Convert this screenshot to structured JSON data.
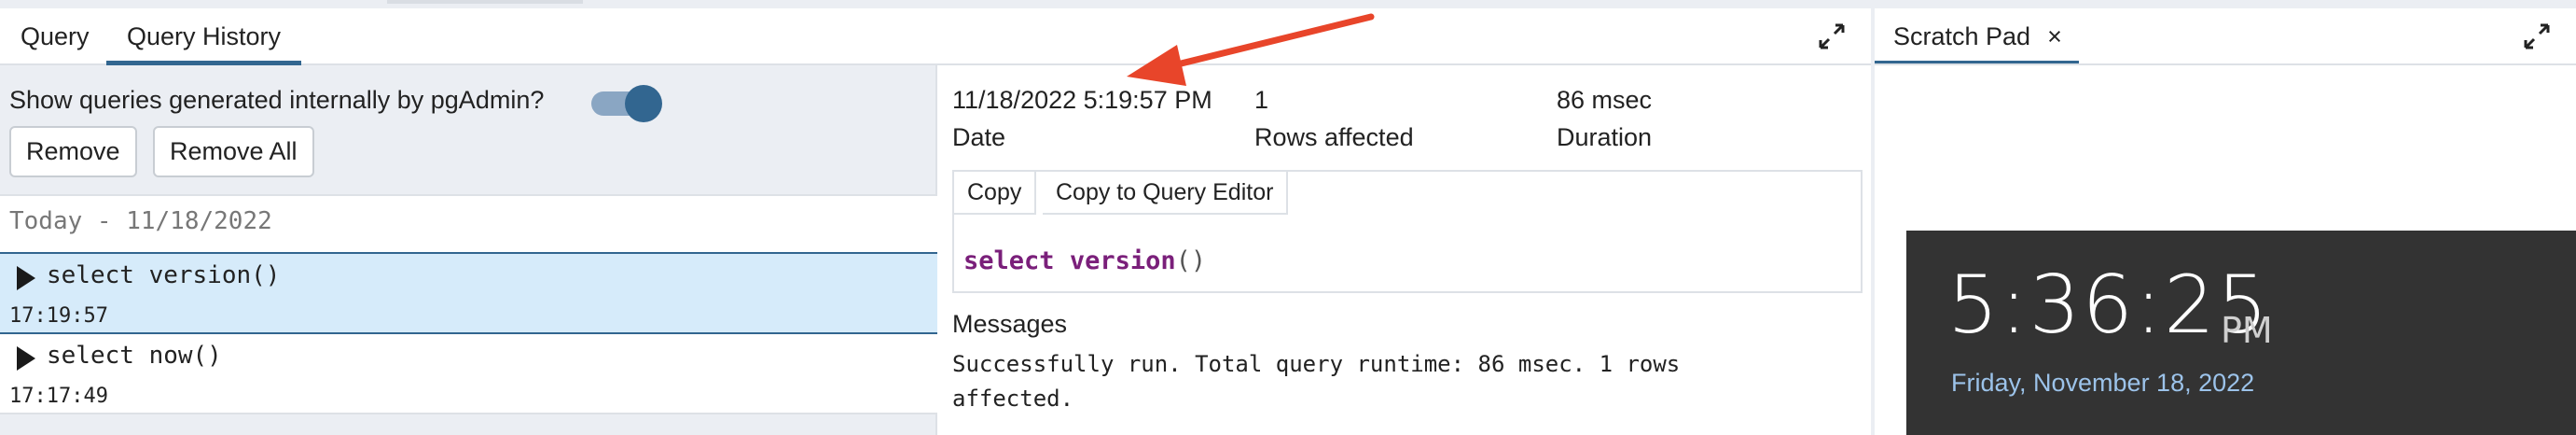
{
  "tabs": [
    {
      "label": "Query"
    },
    {
      "label": "Query History"
    }
  ],
  "history": {
    "toggle_label": "Show queries generated internally by pgAdmin?",
    "toggle_on": true,
    "buttons": {
      "remove": "Remove",
      "remove_all": "Remove All"
    },
    "group_header": "Today - 11/18/2022",
    "items": [
      {
        "query": "select version()",
        "time": "17:19:57",
        "selected": true
      },
      {
        "query": "select now()",
        "time": "17:17:49",
        "selected": false
      }
    ]
  },
  "detail": {
    "date_value": "11/18/2022 5:19:57 PM",
    "date_label": "Date",
    "rows_value": "1",
    "rows_label": "Rows affected",
    "duration_value": "86 msec",
    "duration_label": "Duration",
    "copy_label": "Copy",
    "copy_editor_label": "Copy to Query Editor",
    "code_keyword1": "select",
    "code_keyword2": "version",
    "code_parens": "()",
    "messages_title": "Messages",
    "messages_body": "Successfully run. Total query runtime: 86 msec. 1 rows affected."
  },
  "scratch": {
    "tab_label": "Scratch Pad",
    "close_glyph": "×"
  },
  "clock": {
    "time": "5:36:25",
    "ampm": "PM",
    "date": "Friday, November 18, 2022"
  },
  "colors": {
    "accent": "#326690",
    "selected_row": "#d6ebfa",
    "arrow": "#e8452a",
    "clock_bg": "#333333",
    "clock_date": "#9cc3ea"
  }
}
